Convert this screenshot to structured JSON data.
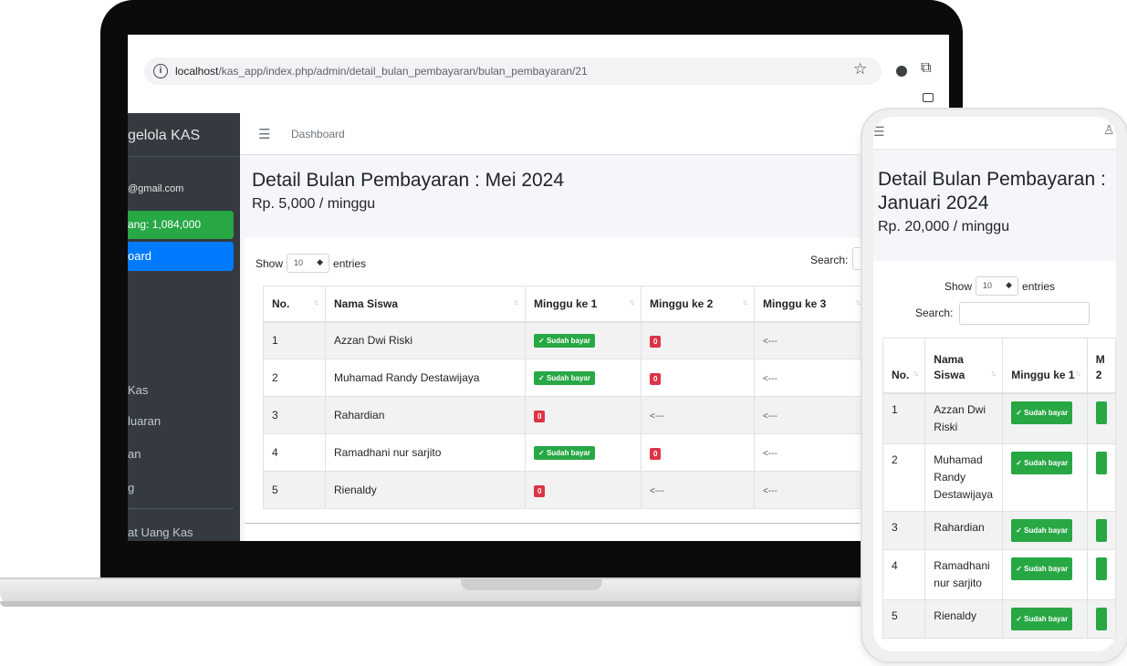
{
  "browser": {
    "url_host": "localhost",
    "url_path": "/kas_app/index.php/admin/detail_bulan_pembayaran/bulan_pembayaran/21"
  },
  "sidebar": {
    "brand": "gelola KAS",
    "email": "@gmail.com",
    "saldo": "ang: 1,084,000",
    "active_item": "oard",
    "items": [
      "Kas",
      "luaran",
      "an",
      "g"
    ],
    "footer_item": "at Uang Kas"
  },
  "topnav": {
    "link": "Dashboard"
  },
  "page": {
    "title": "Detail Bulan Pembayaran : Mei 2024",
    "subtitle": "Rp. 5,000 / minggu"
  },
  "datatable": {
    "show_label": "Show",
    "length_value": "10",
    "entries_label": "entries",
    "search_label": "Search:",
    "headers": [
      "No.",
      "Nama Siswa",
      "Minggu ke 1",
      "Minggu ke 2",
      "Minggu ke 3"
    ],
    "rows": [
      [
        "1",
        "Azzan Dwi Riski",
        "Sudah bayar",
        "0",
        "<---"
      ],
      [
        "2",
        "Muhamad Randy Destawijaya",
        "Sudah bayar",
        "0",
        "<---"
      ],
      [
        "3",
        "Rahardian",
        "0",
        "<---",
        "<---"
      ],
      [
        "4",
        "Ramadhani nur sarjito",
        "Sudah bayar",
        "0",
        "<---"
      ],
      [
        "5",
        "Rienaldy",
        "0",
        "<---",
        "<---"
      ]
    ]
  },
  "mobile": {
    "title": "Detail Bulan Pembayaran : Januari 2024",
    "subtitle": "Rp. 20,000 / minggu",
    "show_label": "Show",
    "length_value": "10",
    "entries_label": "entries",
    "search_label": "Search:",
    "headers": [
      "No.",
      "Nama Siswa",
      "Minggu ke 1",
      "M 2"
    ],
    "rows": [
      [
        "1",
        "Azzan Dwi Riski",
        "Sudah bayar"
      ],
      [
        "2",
        "Muhamad Randy Destawijaya",
        "Sudah bayar"
      ],
      [
        "3",
        "Rahardian",
        "Sudah bayar"
      ],
      [
        "4",
        "Ramadhani nur sarjito",
        "Sudah bayar"
      ],
      [
        "5",
        "Rienaldy",
        "Sudah bayar"
      ]
    ]
  },
  "colors": {
    "paid": "#28a745",
    "unpaid": "#dc3545",
    "sidebar": "#343a40",
    "active": "#007bff"
  }
}
